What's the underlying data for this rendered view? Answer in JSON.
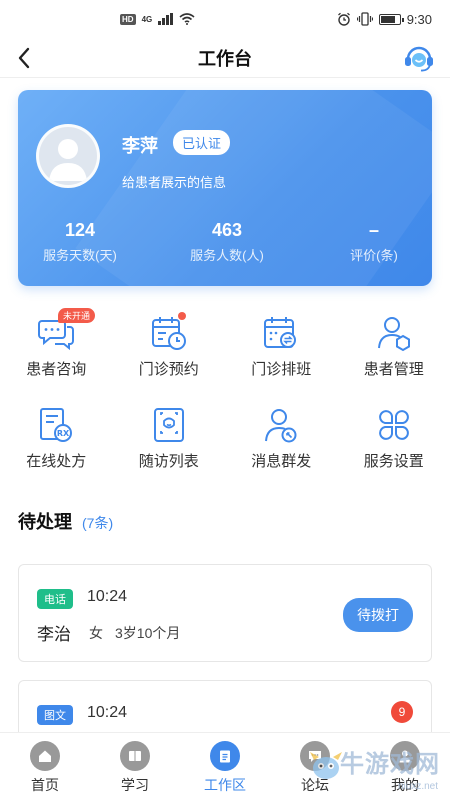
{
  "status_bar": {
    "badge": "HD",
    "network": "4G",
    "time": "9:30"
  },
  "header": {
    "title": "工作台"
  },
  "profile": {
    "name": "李萍",
    "verified_label": "已认证",
    "description": "给患者展示的信息",
    "stats": [
      {
        "value": "124",
        "label": "服务天数(天)"
      },
      {
        "value": "463",
        "label": "服务人数(人)"
      },
      {
        "value": "–",
        "label": "评价(条)"
      }
    ]
  },
  "features": [
    {
      "label": "患者咨询",
      "icon": "chat-bubbles-icon",
      "tag": "未开通"
    },
    {
      "label": "门诊预约",
      "icon": "calendar-clock-icon",
      "dot": true
    },
    {
      "label": "门诊排班",
      "icon": "calendar-swap-icon"
    },
    {
      "label": "患者管理",
      "icon": "user-hexagon-icon"
    },
    {
      "label": "在线处方",
      "icon": "prescription-icon"
    },
    {
      "label": "随访列表",
      "icon": "face-scan-icon"
    },
    {
      "label": "消息群发",
      "icon": "user-broadcast-icon"
    },
    {
      "label": "服务设置",
      "icon": "four-petal-icon"
    }
  ],
  "pending": {
    "title": "待处理",
    "count": "(7条)"
  },
  "tasks": [
    {
      "type": "电话",
      "time": "10:24",
      "name": "李治",
      "gender": "女",
      "age": "3岁10个月",
      "action": "待拨打"
    },
    {
      "type": "图文",
      "time": "10:24",
      "unread": "9"
    }
  ],
  "tabs": [
    {
      "label": "首页",
      "icon": "home-icon"
    },
    {
      "label": "学习",
      "icon": "book-icon"
    },
    {
      "label": "工作区",
      "icon": "clipboard-icon",
      "active": true
    },
    {
      "label": "论坛",
      "icon": "forum-icon"
    },
    {
      "label": "我的",
      "icon": "profile-icon"
    }
  ],
  "watermark": {
    "text": "牛游戏网",
    "url": "niuxz.net"
  },
  "colors": {
    "primary": "#3f88ea",
    "success": "#1fbe8a",
    "danger": "#f04a3a"
  }
}
